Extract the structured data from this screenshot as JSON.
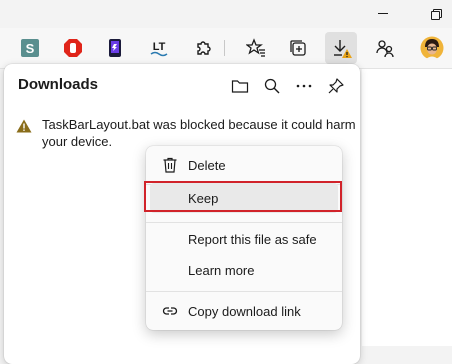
{
  "toolbar": {
    "buttons": [
      {
        "name": "extension-s",
        "letter": "S",
        "color": "#5a8f8f"
      },
      {
        "name": "extension-stop",
        "color": "#e0251a"
      },
      {
        "name": "extension-phone",
        "color": "#6a3de8"
      },
      {
        "name": "extension-languagetool",
        "letter": "LT"
      }
    ]
  },
  "downloads": {
    "title": "Downloads",
    "warning": "TaskBarLayout.bat was blocked because it could harm your device."
  },
  "menu": {
    "delete": "Delete",
    "keep": "Keep",
    "report": "Report this file as safe",
    "learn_more": "Learn more",
    "copy_link": "Copy download link"
  },
  "colors": {
    "highlight": "#d1232a",
    "warning": "#8a6d1a"
  }
}
